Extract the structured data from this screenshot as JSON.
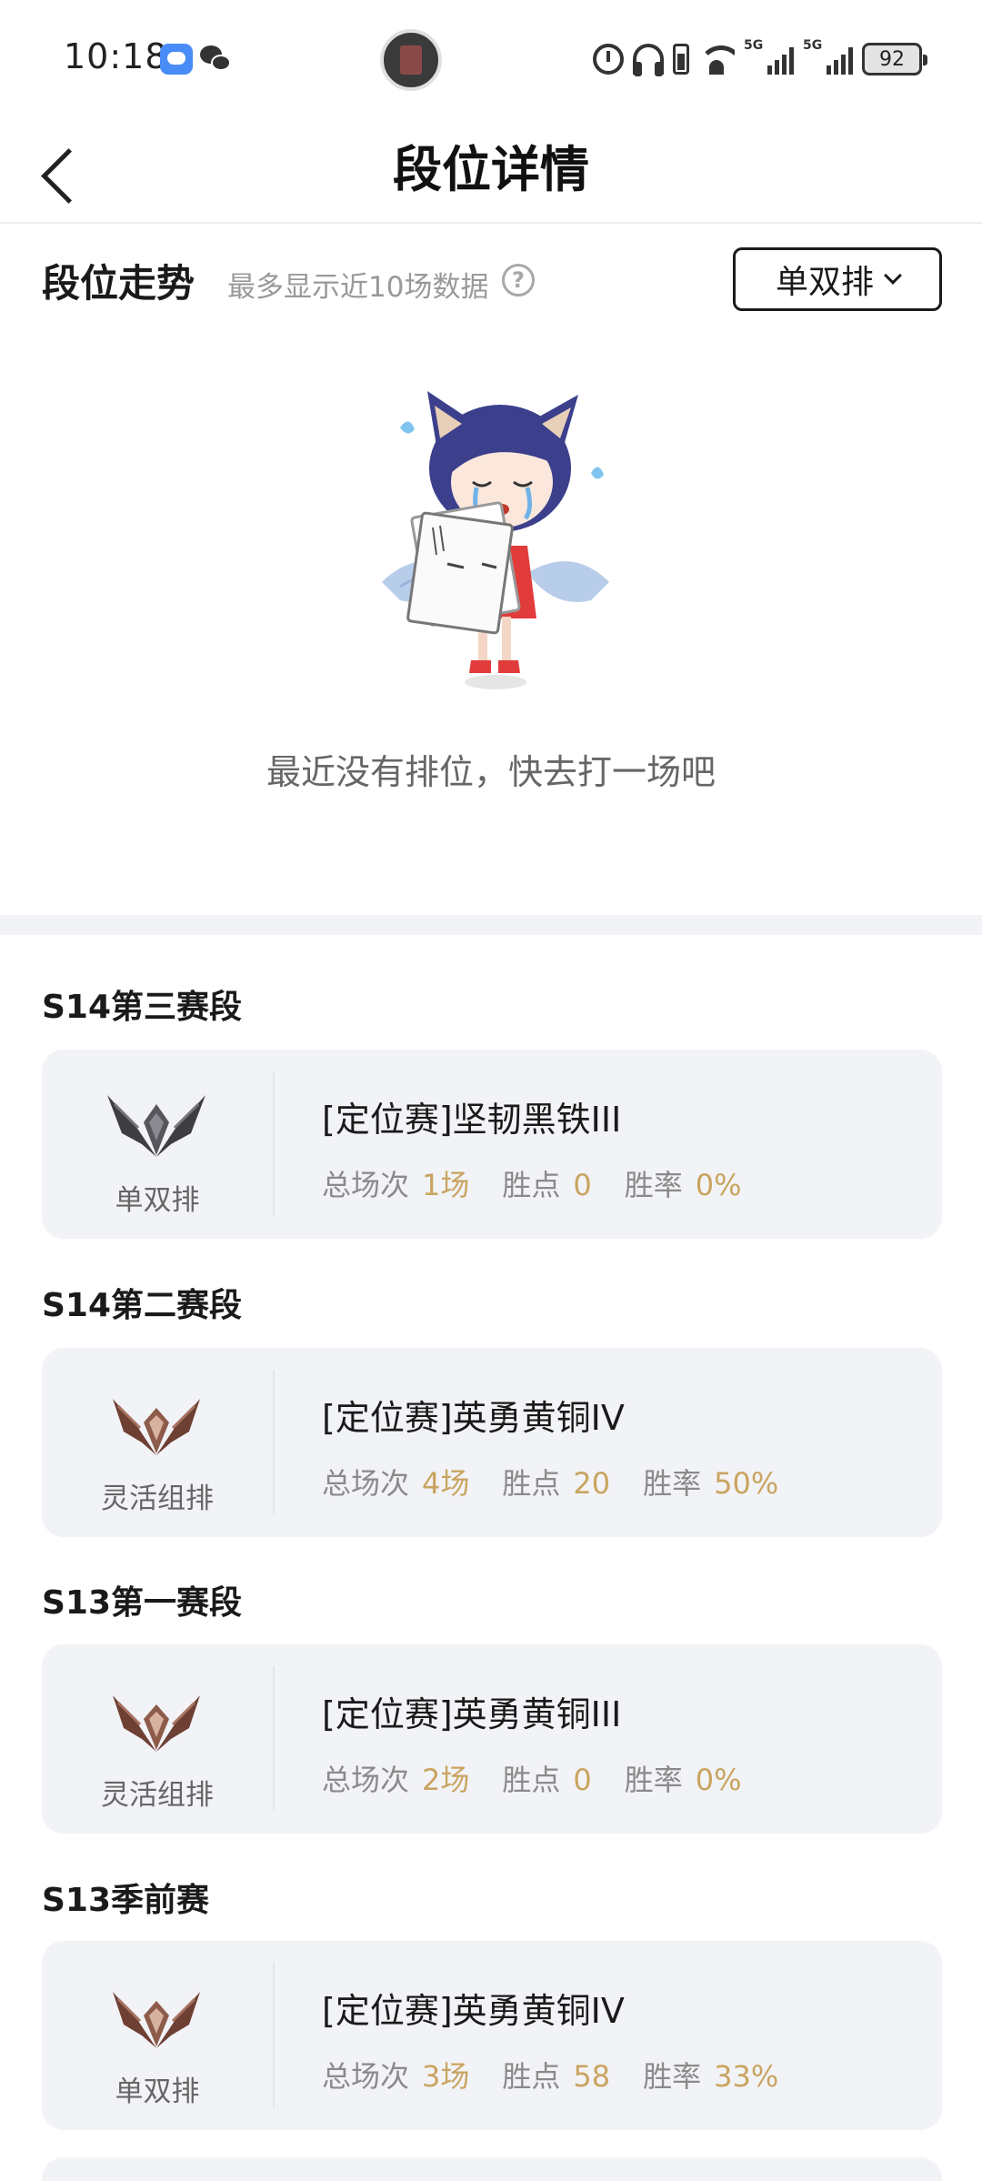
{
  "status_bar": {
    "time": "10:18",
    "battery": "92",
    "signal_1": "5G",
    "signal_2": "5G"
  },
  "nav": {
    "title": "段位详情"
  },
  "trend": {
    "title": "段位走势",
    "subtitle": "最多显示近10场数据",
    "help": "?",
    "mode_label": "单双排",
    "empty_text": "最近没有排位，快去打一场吧"
  },
  "stat_labels": {
    "total": "总场次",
    "points": "胜点",
    "winrate": "胜率"
  },
  "seasons": [
    {
      "title": "S14第三赛段",
      "queue": "单双排",
      "rank": "[定位赛]坚韧黑铁III",
      "emblem": "iron-emblem-icon",
      "total": "1场",
      "points": "0",
      "winrate": "0%"
    },
    {
      "title": "S14第二赛段",
      "queue": "灵活组排",
      "rank": "[定位赛]英勇黄铜IV",
      "emblem": "bronze-emblem-icon",
      "total": "4场",
      "points": "20",
      "winrate": "50%"
    },
    {
      "title": "S13第一赛段",
      "queue": "灵活组排",
      "rank": "[定位赛]英勇黄铜III",
      "emblem": "bronze-emblem-icon",
      "total": "2场",
      "points": "0",
      "winrate": "0%"
    },
    {
      "title": "S13季前赛",
      "queue": "单双排",
      "rank": "[定位赛]英勇黄铜IV",
      "emblem": "bronze-emblem-icon",
      "total": "3场",
      "points": "58",
      "winrate": "33%"
    }
  ],
  "colors": {
    "accent_value": "#c9a460",
    "card_bg": "#f2f3f7",
    "iron": "#4a4a4e",
    "bronze": "#7a4a3c"
  }
}
